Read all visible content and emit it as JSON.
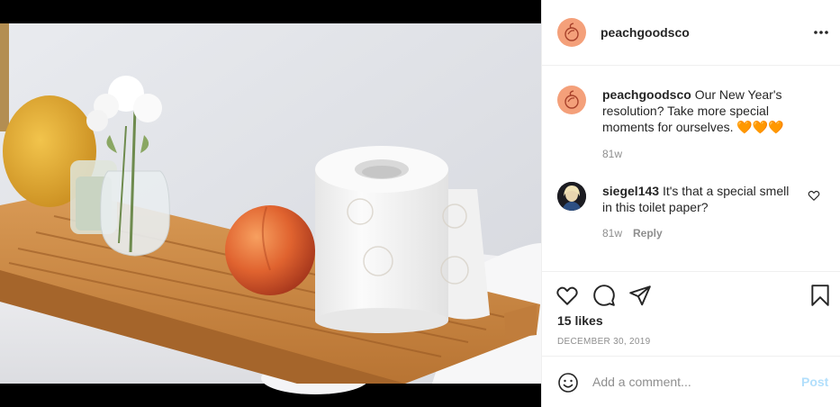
{
  "header": {
    "username": "peachgoodsco"
  },
  "caption": {
    "username": "peachgoodsco",
    "text": "Our New Year's resolution? Take more special moments for ourselves. 🧡🧡🧡",
    "time": "81w"
  },
  "comment": {
    "username": "siegel143",
    "text": "It's that a special smell in this toilet paper?",
    "time": "81w",
    "reply_label": "Reply"
  },
  "actions": {
    "likes": "15 likes",
    "date": "DECEMBER 30, 2019"
  },
  "add_comment": {
    "placeholder": "Add a comment...",
    "post_label": "Post"
  },
  "colors": {
    "brand_avatar": "#f4a07a",
    "post_disabled": "#b2dffc",
    "secondary_text": "#8e8e8e"
  },
  "icons": [
    "more-options-icon",
    "heart-icon",
    "comment-bubble-icon",
    "share-paper-plane-icon",
    "bookmark-icon",
    "emoji-icon",
    "peach-logo-icon"
  ]
}
